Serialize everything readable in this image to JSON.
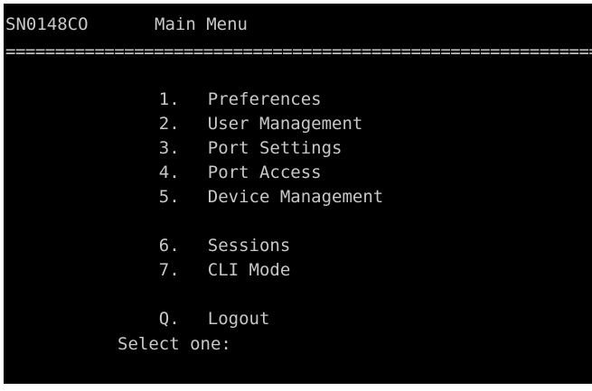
{
  "terminal": {
    "hostname": "SN0148CO",
    "title": "Main Menu",
    "separator": "========================================================================================",
    "menu_items": [
      {
        "key": "1.",
        "label": "Preferences"
      },
      {
        "key": "2.",
        "label": "User Management"
      },
      {
        "key": "3.",
        "label": "Port Settings"
      },
      {
        "key": "4.",
        "label": "Port Access"
      },
      {
        "key": "5.",
        "label": "Device Management"
      },
      {
        "key": "6.",
        "label": "Sessions"
      },
      {
        "key": "7.",
        "label": "CLI Mode"
      },
      {
        "key": "Q.",
        "label": "Logout"
      }
    ],
    "prompt": "Select one:"
  },
  "colors": {
    "background": "#000000",
    "text": "#c8c8c8"
  }
}
